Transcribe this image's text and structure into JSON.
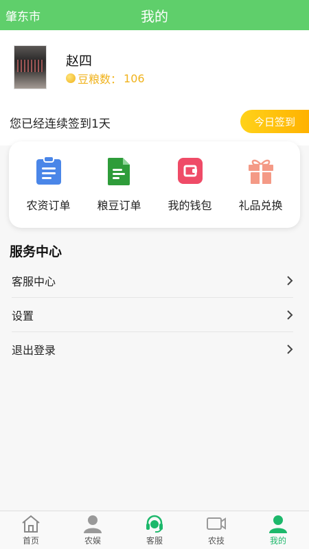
{
  "header": {
    "city": "肇东市",
    "title": "我的"
  },
  "profile": {
    "name": "赵四",
    "points_label": "豆粮数：",
    "points_value": "106"
  },
  "sign": {
    "text": "您已经连续签到1天",
    "button": "今日签到"
  },
  "quick_actions": [
    {
      "label": "农资订单",
      "icon": "clipboard-icon",
      "color": "#4a86e8"
    },
    {
      "label": "粮豆订单",
      "icon": "document-icon",
      "color": "#2e9c3a"
    },
    {
      "label": "我的钱包",
      "icon": "wallet-icon",
      "color": "#ef4b67"
    },
    {
      "label": "礼品兑换",
      "icon": "gift-icon",
      "color": "#f49a86"
    }
  ],
  "service": {
    "title": "服务中心",
    "items": [
      {
        "label": "客服中心"
      },
      {
        "label": "设置"
      },
      {
        "label": "退出登录"
      }
    ]
  },
  "tabbar": {
    "items": [
      {
        "label": "首页",
        "icon": "home-icon",
        "active": false
      },
      {
        "label": "农娱",
        "icon": "person-icon",
        "active": false
      },
      {
        "label": "客服",
        "icon": "headset-icon",
        "active": false
      },
      {
        "label": "农技",
        "icon": "video-icon",
        "active": false
      },
      {
        "label": "我的",
        "icon": "profile-icon",
        "active": true
      }
    ],
    "active_color": "#1db86b"
  },
  "colors": {
    "primary": "#5fcf6b",
    "accent": "#ffb200",
    "points": "#f0b21b"
  }
}
